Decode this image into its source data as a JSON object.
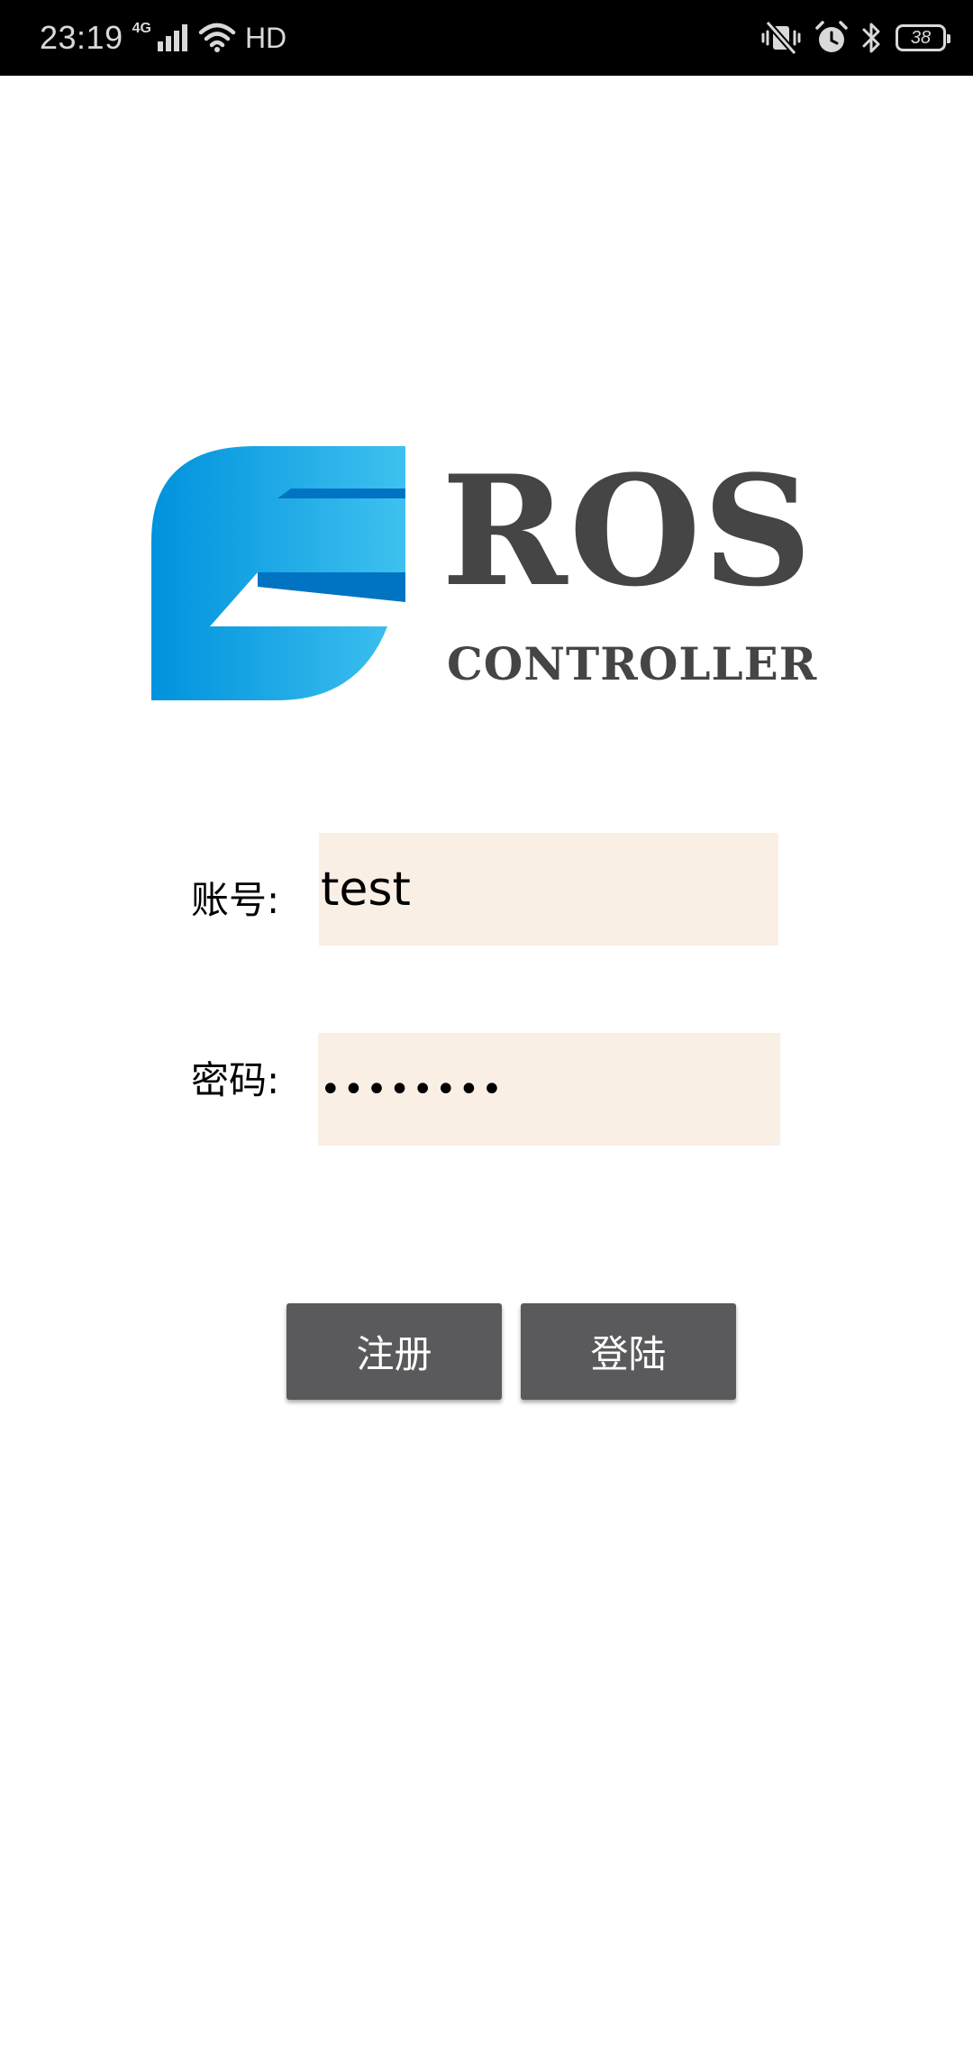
{
  "status_bar": {
    "time": "23:19",
    "network_label": "4G",
    "hd_label": "HD",
    "battery_level": "38"
  },
  "logo": {
    "title": "ROS",
    "subtitle": "CONTROLLER",
    "colors": {
      "mark_light": "#3ec1ef",
      "mark_dark": "#0092dd",
      "text": "#454545"
    }
  },
  "form": {
    "account_label": "账号:",
    "account_value": "test",
    "password_label": "密码:",
    "password_value": "••••••••",
    "field_background": "#faefe5"
  },
  "buttons": {
    "register_label": "注册",
    "login_label": "登陆",
    "background": "#5a5a5c"
  }
}
